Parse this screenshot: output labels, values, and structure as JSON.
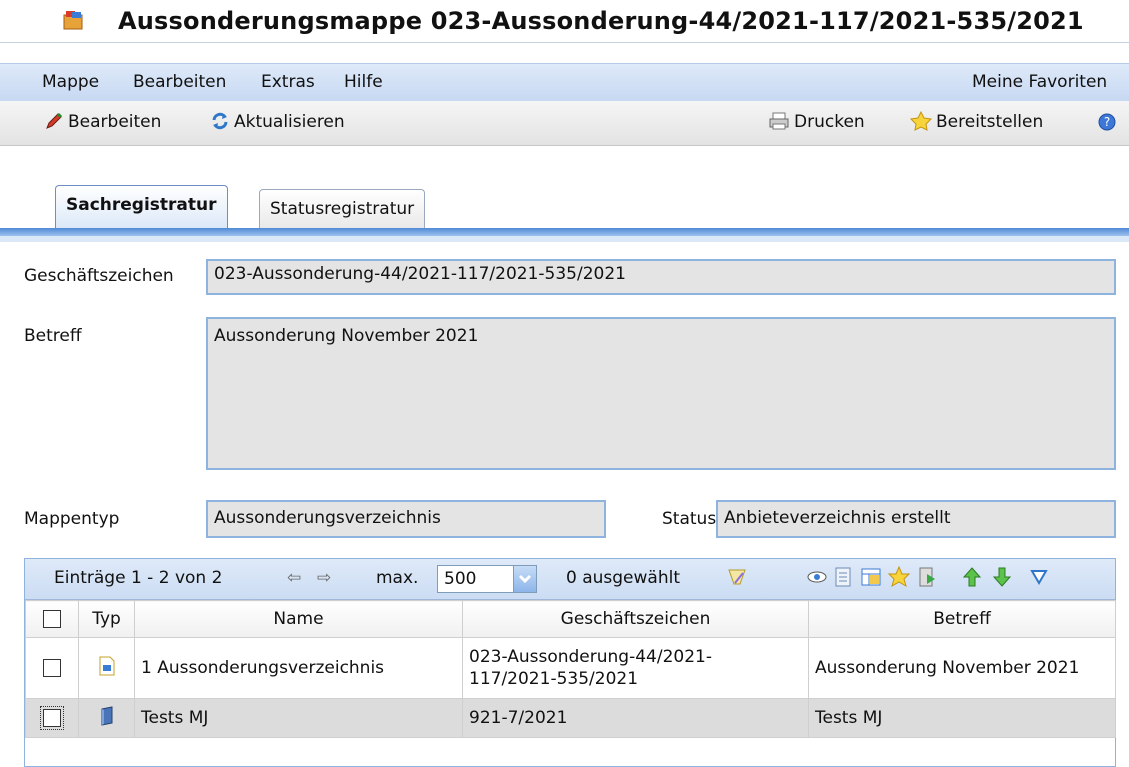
{
  "window": {
    "title": "Aussonderungsmappe 023-Aussonderung-44/2021-117/2021-535/2021",
    "app_icon": "folder-icon"
  },
  "menu": {
    "items": [
      "Mappe",
      "Bearbeiten",
      "Extras",
      "Hilfe"
    ],
    "favorites": "Meine Favoriten"
  },
  "toolbar": {
    "edit": "Bearbeiten",
    "refresh": "Aktualisieren",
    "print": "Drucken",
    "provide": "Bereitstellen"
  },
  "tabs": [
    {
      "label": "Sachregistratur",
      "active": true
    },
    {
      "label": "Statusregistratur",
      "active": false
    }
  ],
  "form": {
    "geschaeftszeichen_label": "Geschäftszeichen",
    "geschaeftszeichen_value": "023-Aussonderung-44/2021-117/2021-535/2021",
    "betreff_label": "Betreff",
    "betreff_value": "Aussonderung November 2021",
    "mappentyp_label": "Mappentyp",
    "mappentyp_value": "Aussonderungsverzeichnis",
    "status_label": "Status",
    "status_value": "Anbieteverzeichnis erstellt"
  },
  "grid": {
    "entries": "Einträge 1 - 2 von 2",
    "max_label": "max.",
    "max_value": "500",
    "selected": "0 ausgewählt",
    "columns": [
      "Typ",
      "Name",
      "Geschäftszeichen",
      "Betreff"
    ],
    "rows": [
      {
        "typ_icon": "document-icon",
        "name": "1 Aussonderungsverzeichnis",
        "gz1": "023-Aussonderung-44/2021-",
        "gz2": "117/2021-535/2021",
        "betreff": "Aussonderung November 2021"
      },
      {
        "typ_icon": "binder-icon",
        "name": "Tests MJ",
        "gz1": "921-7/2021",
        "gz2": "",
        "betreff": "Tests MJ"
      }
    ]
  },
  "colors": {
    "accent": "#4f8ad6",
    "field_bg": "#e4e4e4",
    "field_border": "#8fb3df"
  }
}
